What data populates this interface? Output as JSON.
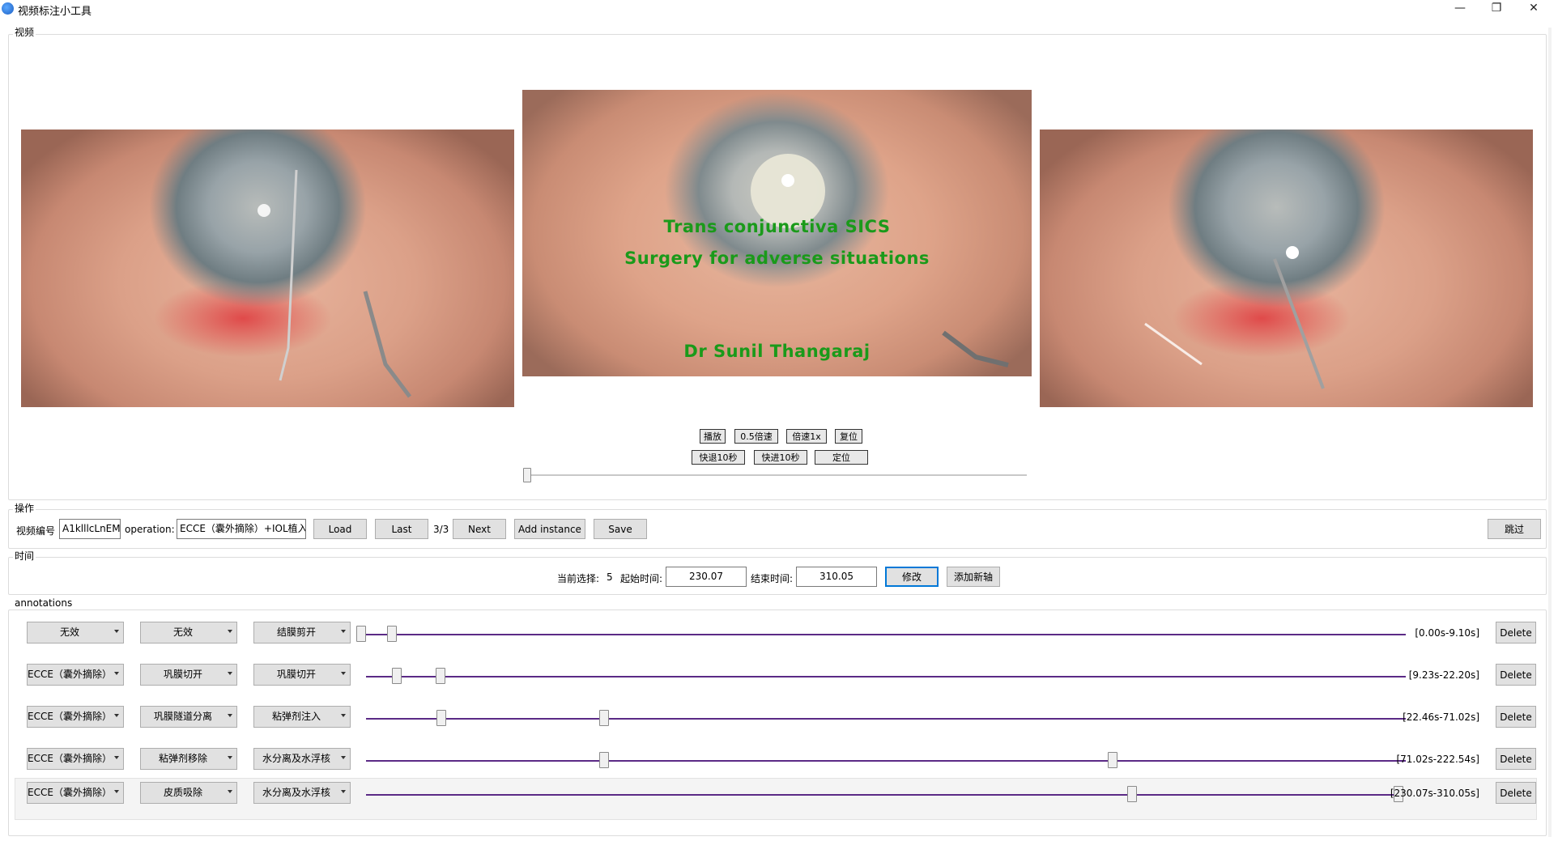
{
  "window": {
    "title": "视频标注小工具",
    "minimize": "—",
    "restore": "❐",
    "close": "✕"
  },
  "video_group": {
    "label": "视频",
    "center_overlay": {
      "line1": "Trans conjunctiva SICS",
      "line2": "Surgery for adverse situations",
      "line3": "Dr Sunil Thangaraj"
    },
    "controls": {
      "play": "播放",
      "half_speed": "0.5倍速",
      "speed_1x": "倍速1x",
      "reset": "复位",
      "rewind": "快退10秒",
      "forward": "快进10秒",
      "locate": "定位"
    },
    "progress": 0.0
  },
  "ops_group": {
    "label": "操作",
    "video_id_label": "视频编号",
    "video_id_value": "A1klllcLnEM",
    "operation_label": "operation:",
    "operation_value": "ECCE（囊外摘除）+IOL植入",
    "load": "Load",
    "last": "Last",
    "page": "3/3",
    "next": "Next",
    "add_instance": "Add instance",
    "save": "Save",
    "skip": "跳过"
  },
  "time_group": {
    "label": "时间",
    "current_label": "当前选择:",
    "current_value": "5",
    "start_label": "起始时间:",
    "start_value": "230.07",
    "end_label": "结束时间:",
    "end_value": "310.05",
    "modify": "修改",
    "add_axis": "添加新轴"
  },
  "annotations": {
    "label": "annotations",
    "delete_label": "Delete",
    "total_duration": 310.05,
    "rows": [
      {
        "c1": "无效",
        "c2": "无效",
        "c3": "结膜剪开",
        "start": 0.0,
        "end": 9.1,
        "range": "[0.00s-9.10s]"
      },
      {
        "c1": "ECCE（囊外摘除）",
        "c2": "巩膜切开",
        "c3": "巩膜切开",
        "start": 9.23,
        "end": 22.2,
        "range": "[9.23s-22.20s]"
      },
      {
        "c1": "ECCE（囊外摘除）",
        "c2": "巩膜隧道分离",
        "c3": "粘弹剂注入",
        "start": 22.46,
        "end": 71.02,
        "range": "[22.46s-71.02s]"
      },
      {
        "c1": "ECCE（囊外摘除）",
        "c2": "粘弹剂移除",
        "c3": "水分离及水浮核",
        "start": 71.02,
        "end": 222.54,
        "range": "[71.02s-222.54s]"
      },
      {
        "c1": "ECCE（囊外摘除）",
        "c2": "皮质吸除",
        "c3": "水分离及水浮核",
        "start": 230.07,
        "end": 310.05,
        "range": "[230.07s-310.05s]"
      }
    ]
  }
}
